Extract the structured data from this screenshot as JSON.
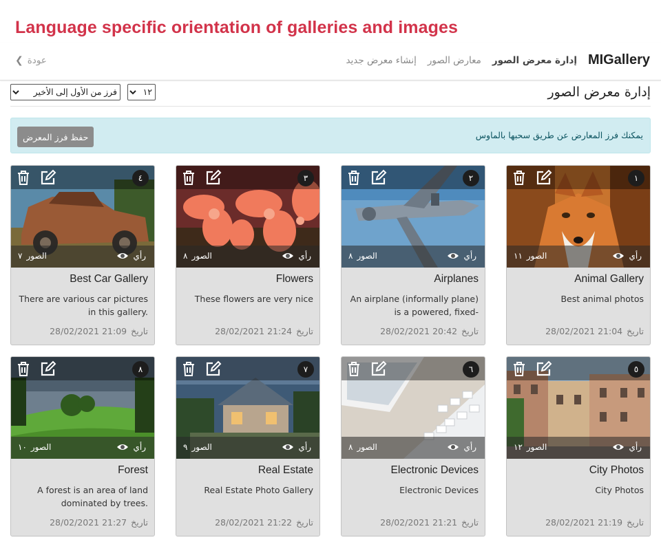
{
  "page": {
    "heading": "Language specific orientation of galleries and images"
  },
  "navbar": {
    "brand": "MIGallery",
    "links": [
      "إدارة معرض الصور",
      "معارض الصور",
      "إنشاء معرض جديد"
    ],
    "back": "عودة"
  },
  "toolbar": {
    "title": "إدارة معرض الصور",
    "sort_selected": "فرز من الأول إلى الأخير",
    "count_selected": "١٢"
  },
  "alert": {
    "text": "يمكنك فرز المعارض عن طريق سحبها بالماوس",
    "save_button": "حفظ فرز المعرض"
  },
  "labels": {
    "views": "رأي",
    "photos": "الصور",
    "date": "تاريخ"
  },
  "galleries": [
    {
      "number": "١",
      "title": "Animal Gallery",
      "description": "Best animal photos",
      "date": "28/02/2021 21:04",
      "photos": "١١"
    },
    {
      "number": "٢",
      "title": "Airplanes",
      "description": "An airplane (informally plane) is a powered, fixed-",
      "date": "28/02/2021 20:42",
      "photos": "٨"
    },
    {
      "number": "٣",
      "title": "Flowers",
      "description": "These flowers are very nice",
      "date": "28/02/2021 21:24",
      "photos": "٨"
    },
    {
      "number": "٤",
      "title": "Best Car Gallery",
      "description": "There are various car pictures in this gallery.",
      "date": "28/02/2021 21:09",
      "photos": "٧"
    },
    {
      "number": "٥",
      "title": "City Photos",
      "description": "City Photos",
      "date": "28/02/2021 21:19",
      "photos": "١٢"
    },
    {
      "number": "٦",
      "title": "Electronic Devices",
      "description": "Electronic Devices",
      "date": "28/02/2021 21:21",
      "photos": "٨"
    },
    {
      "number": "٧",
      "title": "Real Estate",
      "description": "Real Estate Photo Gallery",
      "date": "28/02/2021 21:22",
      "photos": "٩"
    },
    {
      "number": "٨",
      "title": "Forest",
      "description": "A forest is an area of land dominated by trees.",
      "date": "28/02/2021 21:27",
      "photos": "١٠"
    }
  ],
  "colors": {
    "heading": "#d2334a",
    "alert_bg": "#d1ecf1",
    "alert_text": "#0c5460",
    "save_button": "#8c8c8c"
  },
  "icons": {
    "delete": "trash-icon",
    "edit": "edit-icon",
    "views": "eye-icon",
    "back": "chevron-left-icon"
  }
}
